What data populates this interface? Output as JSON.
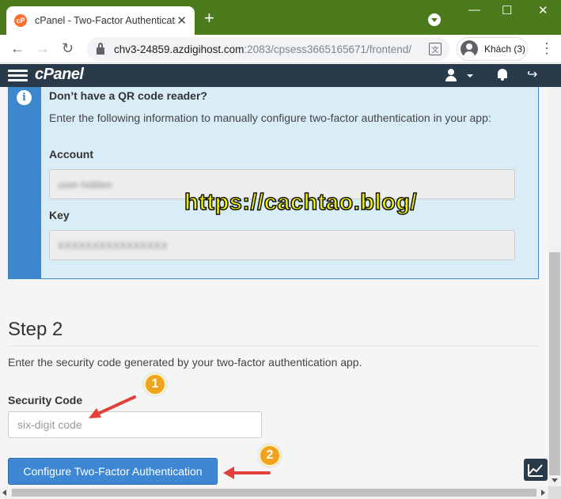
{
  "browser": {
    "tab": {
      "favicon": "cP",
      "title": "cPanel - Two-Factor Authentication",
      "close": "✕"
    },
    "new_tab": "+",
    "window_controls": {
      "minimize": "—",
      "maximize": "☐",
      "close": "✕"
    },
    "nav": {
      "back": "←",
      "forward": "→",
      "reload": "↻"
    },
    "url": {
      "host": "chv3-24859.azdigihost.com",
      "path": ":2083/cpsess3665165671/frontend/"
    },
    "translate_icon": "translate-icon",
    "profile_label": "Khách (3)",
    "menu": "⋮"
  },
  "cpanel_header": {
    "logo": "cPanel",
    "logout_glyph": "↪"
  },
  "manual_config": {
    "info_glyph": "i",
    "title": "Don’t have a QR code reader?",
    "description": "Enter the following information to manually configure two-factor authentication in your app:",
    "account_label": "Account",
    "account_value": "user-hidden",
    "key_label": "Key",
    "key_value": "XXXXXXXXXXXXXXXX"
  },
  "watermark": "https://cachtao.blog/",
  "step2": {
    "title": "Step 2",
    "description": "Enter the security code generated by your two-factor authentication app.",
    "security_code_label": "Security Code",
    "security_code_placeholder": "six-digit code",
    "security_code_value": "",
    "configure_button": "Configure Two-Factor Authentication"
  },
  "annotations": {
    "badge_1": "1",
    "badge_2": "2",
    "badge_color": "#f0a41d",
    "arrow_color": "#e2403a"
  },
  "colors": {
    "browser_frame": "#4a7a1c",
    "cpanel_header": "#293a4a",
    "info_accent": "#3e87cc",
    "info_bg": "#d9edf7",
    "button_primary": "#3e87d4"
  }
}
